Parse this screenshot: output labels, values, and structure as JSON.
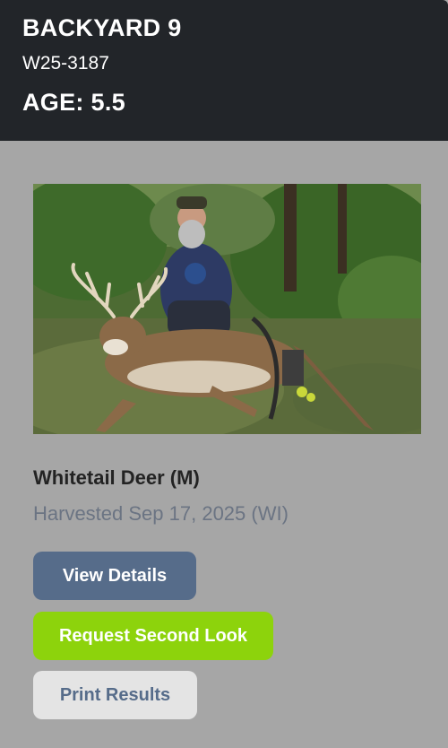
{
  "header": {
    "title": "BACKYARD 9",
    "code": "W25-3187",
    "age": "AGE: 5.5"
  },
  "entry": {
    "species": "Whitetail Deer (M)",
    "harvested": "Harvested Sep 17, 2025 (WI)"
  },
  "buttons": {
    "view_details": "View Details",
    "request_second_look": "Request Second Look",
    "print_results": "Print Results"
  },
  "colors": {
    "header_bg": "#222529",
    "page_bg": "#a6a6a6",
    "view_button": "#566c8a",
    "second_look_button": "#8dd30c",
    "print_button": "#e4e4e4"
  }
}
